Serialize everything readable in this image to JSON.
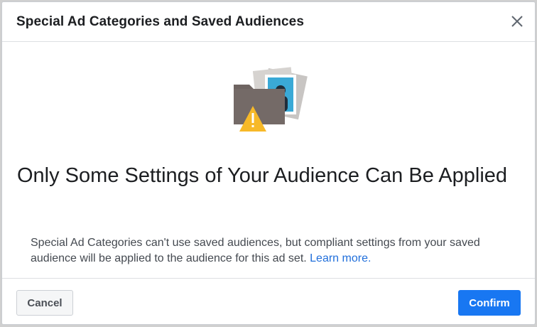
{
  "dialog": {
    "title": "Special Ad Categories and Saved Audiences",
    "close_icon": "close-icon",
    "illustration_icon": "folder-warning-illustration",
    "headline": "Only Some Settings of Your Audience Can Be Applied",
    "body": "Special Ad Categories can't use saved audiences, but compliant settings from your saved audience will be applied to the audience for this ad set.",
    "learn_more": "Learn more."
  },
  "footer": {
    "cancel_label": "Cancel",
    "confirm_label": "Confirm"
  },
  "colors": {
    "confirm_button": "#1877f2",
    "link": "#216fdb",
    "warning": "#f7b928"
  }
}
